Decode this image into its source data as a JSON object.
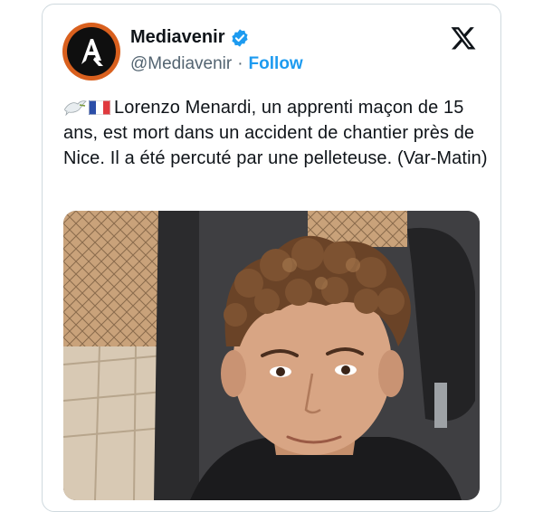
{
  "account": {
    "display_name": "Mediavenir",
    "handle": "@Mediavenir",
    "separator": "·",
    "follow_label": "Follow",
    "verified": true,
    "avatar_icon": "mediavenir-logo-icon",
    "brand_color": "#d9601e"
  },
  "platform_icon": "x-logo-icon",
  "tweet": {
    "emoji_prefix": [
      "dove-icon",
      "france-flag-icon"
    ],
    "text": "Lorenzo Menardi, un apprenti maçon de 15 ans, est mort dans un accident de chantier près de Nice. Il a été percuté par une pelleteuse. (Var-Matin)"
  },
  "media": {
    "type": "photo",
    "subject": "selfie of a young man with curly hair in a car"
  },
  "colors": {
    "text": "#0f1419",
    "secondary": "#536471",
    "accent": "#1d9bf0",
    "border": "#cfd9de"
  }
}
